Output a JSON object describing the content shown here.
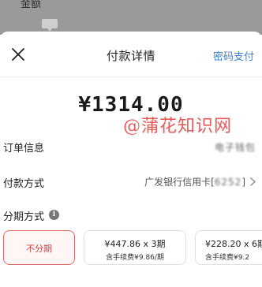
{
  "backdrop": {
    "label": "金额",
    "bubble": ""
  },
  "header": {
    "title": "付款详情",
    "action": "密码支付"
  },
  "amount": "¥1314.00",
  "watermark": "@蒲花知识网",
  "rows": {
    "order_info": {
      "label": "订单信息",
      "value": "电子钱包"
    },
    "payment_method": {
      "label": "付款方式",
      "value": "广发银行信用卡[",
      "masked": "6252",
      "suffix": "]"
    },
    "installment": {
      "label": "分期方式",
      "info_icon": "info-icon"
    }
  },
  "plans": [
    {
      "title": "不分期",
      "sub": "",
      "selected": true
    },
    {
      "title": "¥447.86 x 3期",
      "sub": "含手续费¥9.86/期",
      "selected": false
    },
    {
      "title": "¥228.20 x 6期",
      "sub": "含手续费¥9.2",
      "selected": false
    }
  ],
  "colors": {
    "accent": "#3f7fd1",
    "selected_border": "#e26a6a",
    "watermark": "#e24a4a"
  }
}
